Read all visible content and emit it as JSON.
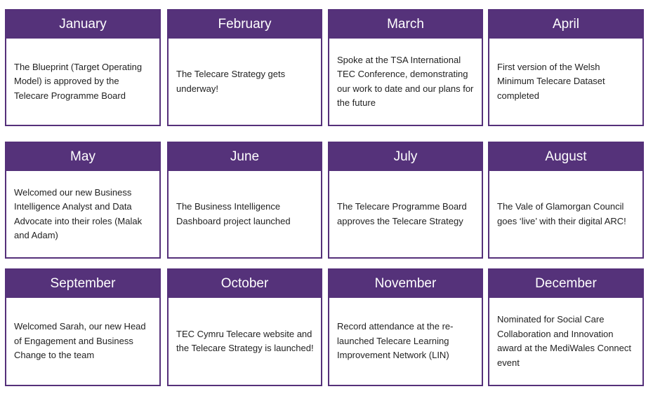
{
  "colors": {
    "header": "#55327a",
    "border": "#55307a",
    "header_text": "#ffffff"
  },
  "months": [
    {
      "name": "January",
      "text": "The Blueprint (Target Operating Model) is approved by the Telecare Programme Board"
    },
    {
      "name": "February",
      "text": "The Telecare Strategy gets underway!"
    },
    {
      "name": "March",
      "text": "Spoke at the TSA International TEC Conference, demonstrating our work to date and our plans for the future"
    },
    {
      "name": "April",
      "text": "First version of the Welsh Minimum Telecare Dataset completed"
    },
    {
      "name": "May",
      "text": "Welcomed our new Business Intelligence Analyst and Data Advocate into their roles (Malak and Adam)"
    },
    {
      "name": "June",
      "text": "The Business Intelligence Dashboard project launched"
    },
    {
      "name": "July",
      "text": "The Telecare Programme Board approves the Telecare Strategy"
    },
    {
      "name": "August",
      "text": "The Vale of Glamorgan Council goes ‘live’ with their digital ARC!"
    },
    {
      "name": "September",
      "text": "Welcomed Sarah, our new Head of Engagement and Business Change to the team"
    },
    {
      "name": "October",
      "text": "TEC Cymru Telecare website and the Telecare Strategy is launched!"
    },
    {
      "name": "November",
      "text": "Record attendance at the re-launched Telecare Learning Improvement Network (LIN)"
    },
    {
      "name": "December",
      "text": "Nominated for Social Care Collaboration and Innovation award at the MediWales Connect event"
    }
  ]
}
